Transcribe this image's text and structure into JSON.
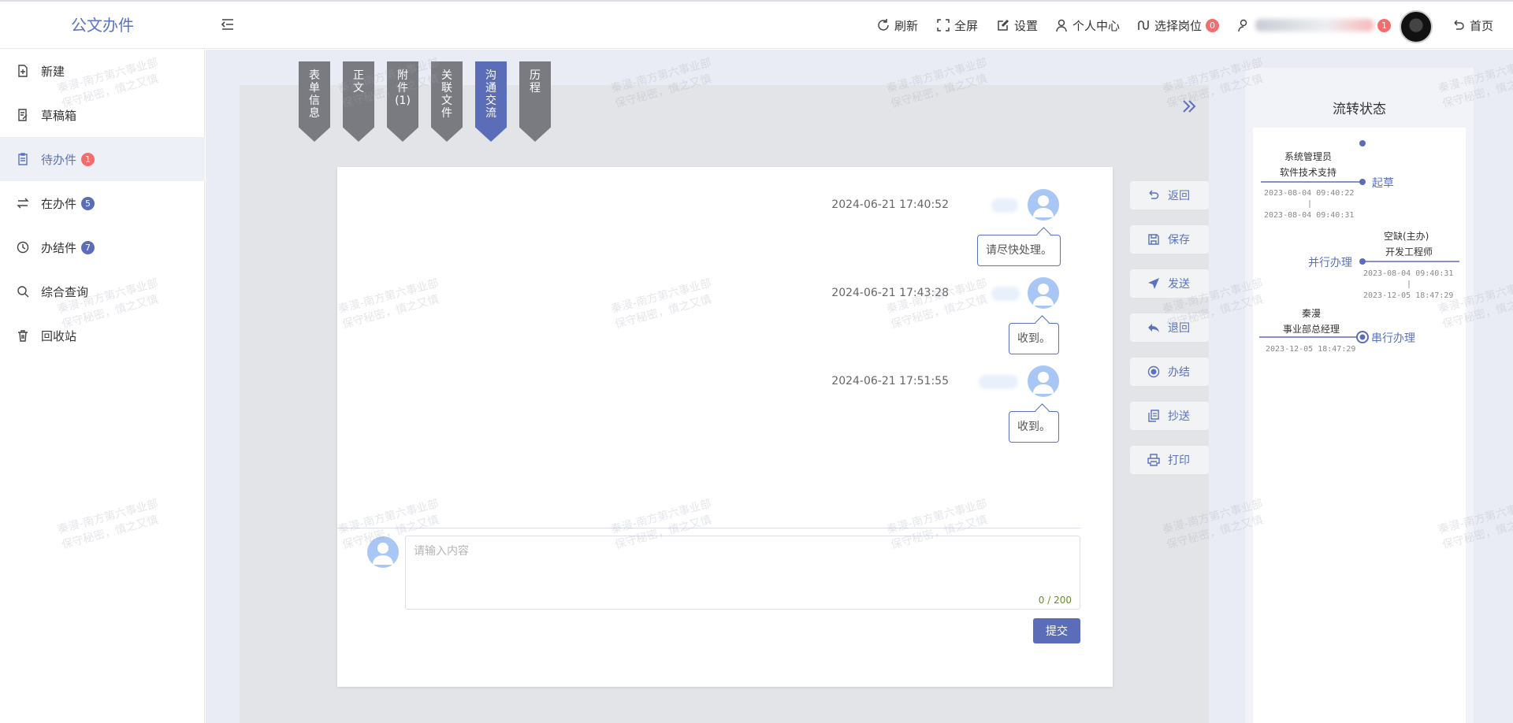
{
  "app": {
    "title": "公文办件"
  },
  "header": {
    "refresh": "刷新",
    "fullscreen": "全屏",
    "settings": "设置",
    "profile": "个人中心",
    "select_post": "选择岗位",
    "select_post_badge": "0",
    "user_badge": "1",
    "home": "首页"
  },
  "sidebar": {
    "items": [
      {
        "label": "新建",
        "icon": "new-doc-icon"
      },
      {
        "label": "草稿箱",
        "icon": "draft-icon"
      },
      {
        "label": "待办件",
        "icon": "todo-icon",
        "badge": "1",
        "badge_color": "#f56c6c"
      },
      {
        "label": "在办件",
        "icon": "in-progress-icon",
        "badge": "5",
        "badge_color": "#5b6db8"
      },
      {
        "label": "办结件",
        "icon": "clock-icon",
        "badge": "7",
        "badge_color": "#5b6db8"
      },
      {
        "label": "综合查询",
        "icon": "search-icon"
      },
      {
        "label": "回收站",
        "icon": "trash-icon"
      }
    ]
  },
  "tabs": [
    {
      "label": [
        "表",
        "单",
        "信",
        "息"
      ]
    },
    {
      "label": [
        "正",
        "文"
      ]
    },
    {
      "label": [
        "附",
        "件",
        "(1)"
      ]
    },
    {
      "label": [
        "关",
        "联",
        "文",
        "件"
      ]
    },
    {
      "label": [
        "沟",
        "通",
        "交",
        "流"
      ],
      "active": true
    },
    {
      "label": [
        "历",
        "程"
      ]
    }
  ],
  "messages": [
    {
      "time": "2024-06-21 17:40:52",
      "text": "请尽快处理。"
    },
    {
      "time": "2024-06-21 17:43:28",
      "text": "收到。"
    },
    {
      "time": "2024-06-21 17:51:55",
      "text": "收到。"
    }
  ],
  "comment": {
    "placeholder": "请输入内容",
    "counter": "0 / 200",
    "submit": "提交"
  },
  "actions": [
    {
      "label": "返回",
      "icon": "undo-icon"
    },
    {
      "label": "保存",
      "icon": "save-icon"
    },
    {
      "label": "发送",
      "icon": "send-icon"
    },
    {
      "label": "退回",
      "icon": "reply-icon"
    },
    {
      "label": "办结",
      "icon": "radio-icon"
    },
    {
      "label": "抄送",
      "icon": "copy-icon"
    },
    {
      "label": "打印",
      "icon": "print-icon"
    }
  ],
  "flow": {
    "title": "流转状态",
    "nodes": [
      {
        "name": "起草",
        "person": "系统管理员",
        "dept": "软件技术支持",
        "start": "2023-08-04 09:40:22",
        "end": "2023-08-04 09:40:31"
      },
      {
        "name": "并行办理",
        "person": "空缺(主办)",
        "dept": "开发工程师",
        "start": "2023-08-04 09:40:31",
        "end": "2023-12-05 18:47:29"
      },
      {
        "name": "串行办理",
        "person": "秦漫",
        "dept": "事业部总经理",
        "start": "2023-12-05 18:47:29"
      }
    ]
  },
  "watermark": {
    "line1": "秦漫-南方第六事业部",
    "line2": "保守秘密，慎之又慎"
  },
  "colors": {
    "accent": "#5b6db8",
    "badge_red": "#f56c6c",
    "tab_gray": "#7a7b80"
  }
}
